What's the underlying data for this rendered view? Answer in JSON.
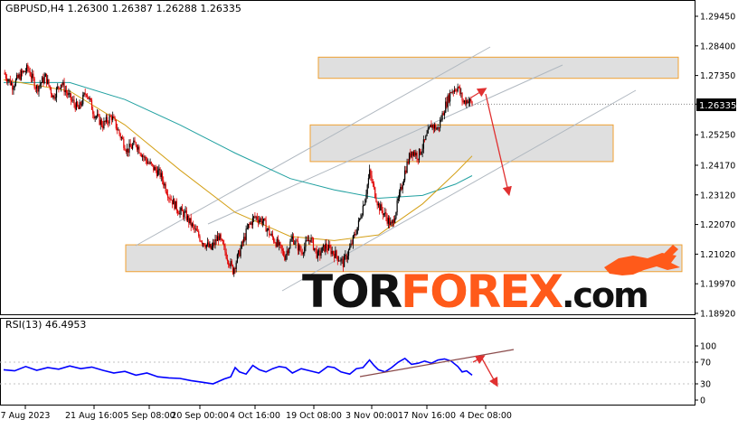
{
  "header": {
    "symbol_line": "GBPUSD,H4  1.26300 1.26387 1.26288 1.26335"
  },
  "rsi_header": "RSI(13) 46.4953",
  "logo": {
    "part1": "TOR",
    "part2": "FOREX",
    "part3": ".com"
  },
  "current_price_label": "1.26335",
  "colors": {
    "bull": "#000000",
    "bear": "#e00000",
    "ma_fast": "#d4a017",
    "ma_slow": "#20a0a0",
    "rsi": "#0000ff",
    "zone": "#d9d9d9",
    "zone_border": "#f0a030",
    "channel": "#b0b8c0",
    "arrow": "#e03030",
    "logo_dark": "#111111",
    "logo_orange": "#ff5a1a"
  },
  "chart_data": [
    {
      "type": "candlestick",
      "title": "GBPUSD,H4",
      "ohlc_latest": {
        "open": 1.263,
        "high": 1.26387,
        "low": 1.26288,
        "close": 1.26335
      },
      "y_ticks": [
        "1.29450",
        "1.28400",
        "1.27350",
        "1.26335",
        "1.25250",
        "1.24170",
        "1.23120",
        "1.22070",
        "1.21020",
        "1.19970",
        "1.18920"
      ],
      "ylim": [
        1.1892,
        1.2945
      ],
      "x_ticks": [
        "7 Aug 2023",
        "21 Aug 16:00",
        "5 Sep 08:00",
        "20 Sep 00:00",
        "4 Oct 16:00",
        "19 Oct 08:00",
        "3 Nov 00:00",
        "17 Nov 16:00",
        "4 Dec 08:00"
      ],
      "close_path": [
        [
          0,
          1.2745
        ],
        [
          8,
          1.27
        ],
        [
          15,
          1.2735
        ],
        [
          22,
          1.276
        ],
        [
          30,
          1.269
        ],
        [
          38,
          1.273
        ],
        [
          45,
          1.266
        ],
        [
          52,
          1.271
        ],
        [
          60,
          1.2655
        ],
        [
          68,
          1.2615
        ],
        [
          75,
          1.268
        ],
        [
          82,
          1.26
        ],
        [
          90,
          1.256
        ],
        [
          98,
          1.259
        ],
        [
          105,
          1.253
        ],
        [
          112,
          1.247
        ],
        [
          120,
          1.2495
        ],
        [
          128,
          1.244
        ],
        [
          135,
          1.241
        ],
        [
          142,
          1.2385
        ],
        [
          150,
          1.231
        ],
        [
          158,
          1.226
        ],
        [
          165,
          1.224
        ],
        [
          172,
          1.2195
        ],
        [
          180,
          1.215
        ],
        [
          188,
          1.212
        ],
        [
          195,
          1.2165
        ],
        [
          202,
          1.21
        ],
        [
          208,
          1.2045
        ],
        [
          215,
          1.212
        ],
        [
          222,
          1.22
        ],
        [
          228,
          1.2235
        ],
        [
          235,
          1.222
        ],
        [
          242,
          1.217
        ],
        [
          248,
          1.214
        ],
        [
          255,
          1.2095
        ],
        [
          262,
          1.216
        ],
        [
          270,
          1.211
        ],
        [
          278,
          1.216
        ],
        [
          285,
          1.2095
        ],
        [
          292,
          1.213
        ],
        [
          300,
          1.2105
        ],
        [
          308,
          1.207
        ],
        [
          315,
          1.213
        ],
        [
          322,
          1.221
        ],
        [
          328,
          1.2305
        ],
        [
          332,
          1.239
        ],
        [
          336,
          1.233
        ],
        [
          340,
          1.2275
        ],
        [
          346,
          1.224
        ],
        [
          352,
          1.22
        ],
        [
          358,
          1.229
        ],
        [
          364,
          1.2395
        ],
        [
          370,
          1.247
        ],
        [
          376,
          1.245
        ],
        [
          382,
          1.25
        ],
        [
          388,
          1.256
        ],
        [
          394,
          1.2545
        ],
        [
          400,
          1.262
        ],
        [
          406,
          1.268
        ],
        [
          412,
          1.2695
        ],
        [
          417,
          1.264
        ],
        [
          421,
          1.265
        ],
        [
          425,
          1.2634
        ]
      ],
      "ma_fast_path": [
        [
          0,
          1.272
        ],
        [
          60,
          1.268
        ],
        [
          110,
          1.256
        ],
        [
          160,
          1.24
        ],
        [
          210,
          1.225
        ],
        [
          260,
          1.2165
        ],
        [
          300,
          1.215
        ],
        [
          340,
          1.217
        ],
        [
          380,
          1.228
        ],
        [
          410,
          1.239
        ],
        [
          425,
          1.245
        ]
      ],
      "ma_slow_path": [
        [
          0,
          1.271
        ],
        [
          60,
          1.271
        ],
        [
          110,
          1.265
        ],
        [
          160,
          1.256
        ],
        [
          210,
          1.246
        ],
        [
          260,
          1.237
        ],
        [
          300,
          1.233
        ],
        [
          340,
          1.23
        ],
        [
          380,
          1.231
        ],
        [
          410,
          1.235
        ],
        [
          425,
          1.238
        ]
      ],
      "zones": [
        {
          "y1": 1.2725,
          "y2": 1.28
        },
        {
          "y1": 1.243,
          "y2": 1.256
        },
        {
          "y1": 1.204,
          "y2": 1.2135
        }
      ]
    },
    {
      "type": "line",
      "title": "RSI(13)",
      "value": 46.4953,
      "ylim": [
        0,
        100
      ],
      "y_ticks": [
        "100",
        "70",
        "30",
        "0"
      ],
      "path": [
        [
          0,
          56
        ],
        [
          10,
          54
        ],
        [
          20,
          62
        ],
        [
          30,
          55
        ],
        [
          40,
          60
        ],
        [
          50,
          57
        ],
        [
          60,
          63
        ],
        [
          70,
          58
        ],
        [
          80,
          61
        ],
        [
          90,
          55
        ],
        [
          100,
          50
        ],
        [
          110,
          53
        ],
        [
          120,
          46
        ],
        [
          130,
          50
        ],
        [
          140,
          43
        ],
        [
          150,
          41
        ],
        [
          160,
          40
        ],
        [
          170,
          36
        ],
        [
          180,
          33
        ],
        [
          190,
          30
        ],
        [
          200,
          39
        ],
        [
          206,
          43
        ],
        [
          210,
          60
        ],
        [
          214,
          52
        ],
        [
          220,
          48
        ],
        [
          226,
          64
        ],
        [
          232,
          56
        ],
        [
          238,
          52
        ],
        [
          244,
          58
        ],
        [
          250,
          62
        ],
        [
          256,
          60
        ],
        [
          262,
          50
        ],
        [
          270,
          58
        ],
        [
          278,
          54
        ],
        [
          286,
          50
        ],
        [
          294,
          62
        ],
        [
          300,
          60
        ],
        [
          306,
          52
        ],
        [
          314,
          48
        ],
        [
          320,
          58
        ],
        [
          326,
          60
        ],
        [
          332,
          74
        ],
        [
          336,
          64
        ],
        [
          340,
          56
        ],
        [
          346,
          52
        ],
        [
          352,
          60
        ],
        [
          358,
          70
        ],
        [
          364,
          77
        ],
        [
          370,
          66
        ],
        [
          376,
          68
        ],
        [
          382,
          72
        ],
        [
          388,
          68
        ],
        [
          394,
          74
        ],
        [
          400,
          76
        ],
        [
          406,
          72
        ],
        [
          412,
          62
        ],
        [
          416,
          52
        ],
        [
          420,
          54
        ],
        [
          425,
          46
        ]
      ]
    }
  ]
}
